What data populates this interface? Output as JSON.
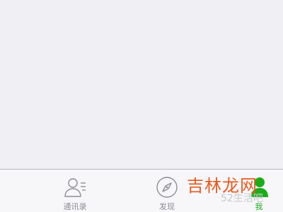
{
  "tabbar": {
    "tabs": [
      {
        "id": "contacts",
        "label": "通讯录",
        "icon": "contacts-icon",
        "active": false
      },
      {
        "id": "discover",
        "label": "发现",
        "icon": "compass-icon",
        "active": false
      },
      {
        "id": "me",
        "label": "我",
        "icon": "person-icon",
        "active": true
      }
    ]
  },
  "watermark": {
    "text": "吉林龙网",
    "sub": "52生活吧"
  },
  "colors": {
    "accent": "#1aad19",
    "inactive": "#8e8e93",
    "background": "#efeff4",
    "tabbar_bg": "#f7f7fa",
    "watermark": "#e8591e"
  }
}
